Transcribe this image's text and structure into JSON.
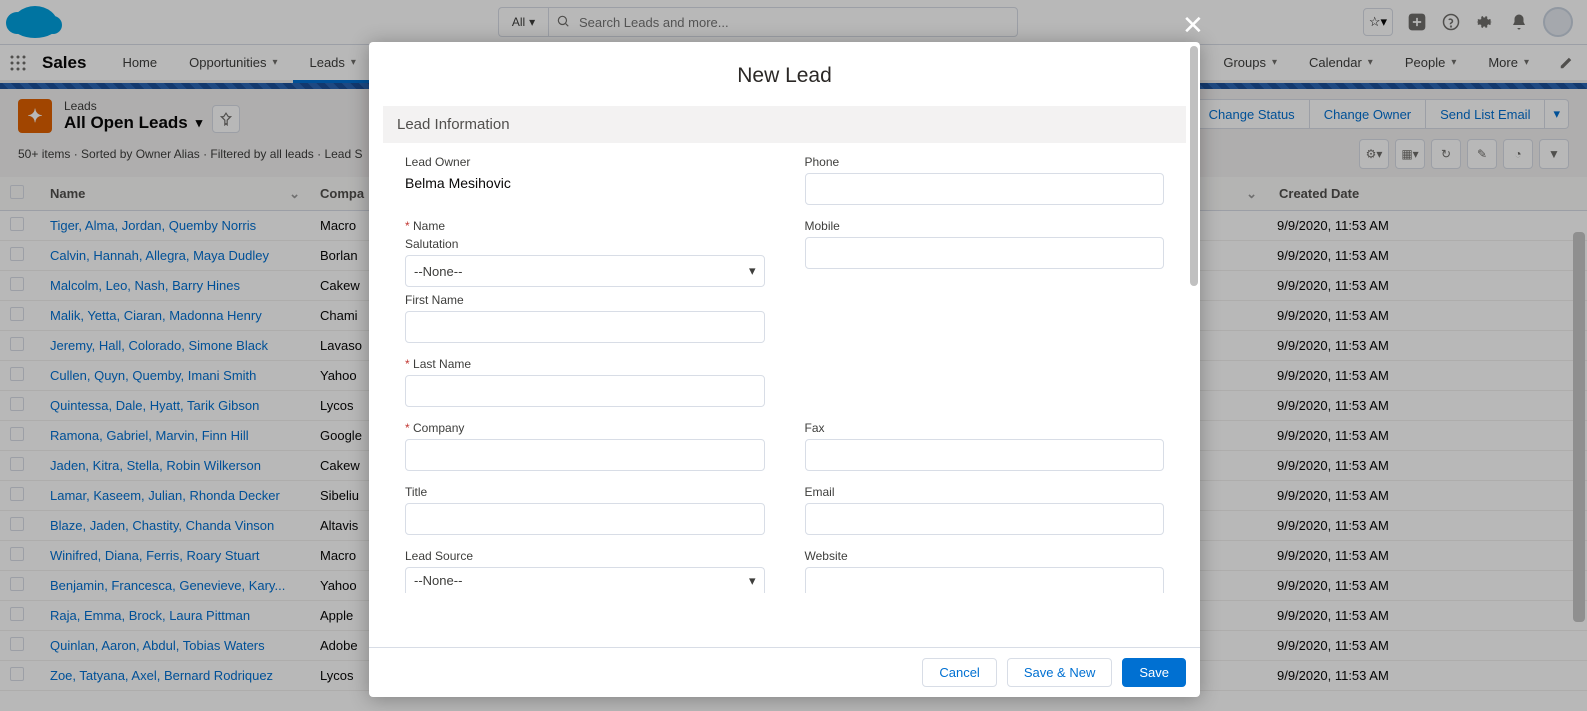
{
  "header": {
    "search_scope": "All",
    "search_placeholder": "Search Leads and more..."
  },
  "app_name": "Sales",
  "nav": {
    "items": [
      {
        "label": "Home",
        "dd": false
      },
      {
        "label": "Opportunities",
        "dd": true
      },
      {
        "label": "Leads",
        "dd": true,
        "active": true
      },
      {
        "label": "Groups",
        "dd": true
      },
      {
        "label": "Calendar",
        "dd": true
      },
      {
        "label": "People",
        "dd": true
      },
      {
        "label": "More",
        "dd": true
      }
    ]
  },
  "page": {
    "object_label": "Leads",
    "list_view": "All Open Leads",
    "meta": "50+ items · Sorted by Owner Alias · Filtered by all leads · Lead S",
    "actions": [
      "Change Status",
      "Change Owner",
      "Send List Email"
    ]
  },
  "columns": {
    "name": "Name",
    "company": "Compa",
    "created": "Created Date"
  },
  "rows": [
    {
      "name": "Tiger, Alma, Jordan, Quemby Norris",
      "company": "Macro",
      "created": "9/9/2020, 11:53 AM"
    },
    {
      "name": "Calvin, Hannah, Allegra, Maya Dudley",
      "company": "Borlan",
      "created": "9/9/2020, 11:53 AM"
    },
    {
      "name": "Malcolm, Leo, Nash, Barry Hines",
      "company": "Cakew",
      "created": "9/9/2020, 11:53 AM"
    },
    {
      "name": "Malik, Yetta, Ciaran, Madonna Henry",
      "company": "Chami",
      "created": "9/9/2020, 11:53 AM"
    },
    {
      "name": "Jeremy, Hall, Colorado, Simone Black",
      "company": "Lavaso",
      "created": "9/9/2020, 11:53 AM"
    },
    {
      "name": "Cullen, Quyn, Quemby, Imani Smith",
      "company": "Yahoo",
      "created": "9/9/2020, 11:53 AM"
    },
    {
      "name": "Quintessa, Dale, Hyatt, Tarik Gibson",
      "company": "Lycos",
      "created": "9/9/2020, 11:53 AM"
    },
    {
      "name": "Ramona, Gabriel, Marvin, Finn Hill",
      "company": "Google",
      "created": "9/9/2020, 11:53 AM"
    },
    {
      "name": "Jaden, Kitra, Stella, Robin Wilkerson",
      "company": "Cakew",
      "created": "9/9/2020, 11:53 AM"
    },
    {
      "name": "Lamar, Kaseem, Julian, Rhonda Decker",
      "company": "Sibeliu",
      "created": "9/9/2020, 11:53 AM"
    },
    {
      "name": "Blaze, Jaden, Chastity, Chanda Vinson",
      "company": "Altavis",
      "created": "9/9/2020, 11:53 AM"
    },
    {
      "name": "Winifred, Diana, Ferris, Roary Stuart",
      "company": "Macro",
      "created": "9/9/2020, 11:53 AM"
    },
    {
      "name": "Benjamin, Francesca, Genevieve, Kary...",
      "company": "Yahoo",
      "created": "9/9/2020, 11:53 AM"
    },
    {
      "name": "Raja, Emma, Brock, Laura Pittman",
      "company": "Apple",
      "created": "9/9/2020, 11:53 AM"
    },
    {
      "name": "Quinlan, Aaron, Abdul, Tobias Waters",
      "company": "Adobe",
      "created": "9/9/2020, 11:53 AM"
    },
    {
      "name": "Zoe, Tatyana, Axel, Bernard Rodriquez",
      "company": "Lycos",
      "created": "9/9/2020, 11:53 AM"
    }
  ],
  "modal": {
    "title": "New Lead",
    "section": "Lead Information",
    "labels": {
      "lead_owner": "Lead Owner",
      "phone": "Phone",
      "name": "Name",
      "mobile": "Mobile",
      "salutation": "Salutation",
      "first_name": "First Name",
      "last_name": "Last Name",
      "company": "Company",
      "fax": "Fax",
      "title": "Title",
      "email": "Email",
      "lead_source": "Lead Source",
      "website": "Website"
    },
    "values": {
      "lead_owner": "Belma Mesihovic",
      "salutation": "--None--",
      "lead_source": "--None--"
    },
    "buttons": {
      "cancel": "Cancel",
      "save_new": "Save & New",
      "save": "Save"
    }
  }
}
